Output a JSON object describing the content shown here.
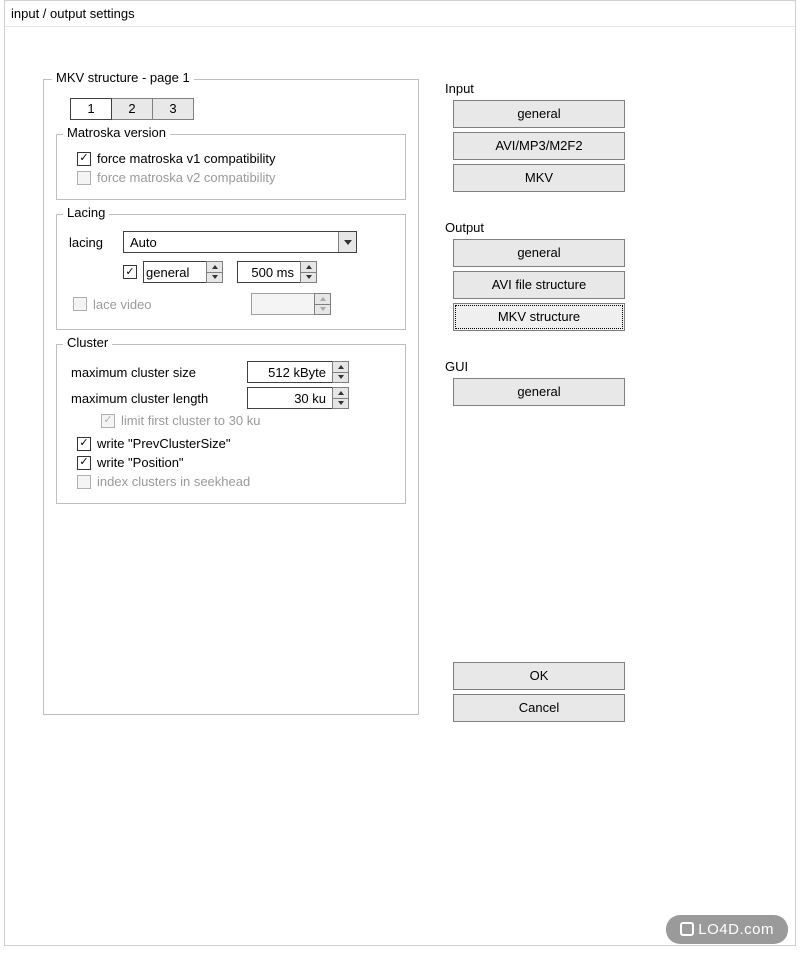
{
  "window": {
    "title": "input / output settings"
  },
  "left": {
    "structure_legend": "MKV structure - page 1",
    "pages": [
      "1",
      "2",
      "3"
    ],
    "active_page": 0,
    "matroska": {
      "legend": "Matroska version",
      "force_v1": {
        "label": "force matroska v1 compatibility",
        "checked": true,
        "enabled": true
      },
      "force_v2": {
        "label": "force matroska v2 compatibility",
        "checked": false,
        "enabled": false
      }
    },
    "lacing": {
      "legend": "Lacing",
      "label": "lacing",
      "mode": "Auto",
      "general_chk": true,
      "general_label": "general",
      "general_value": "",
      "ms_value": "500 ms",
      "lace_video": {
        "label": "lace video",
        "checked": false,
        "enabled": false
      },
      "lace_video_value": ""
    },
    "cluster": {
      "legend": "Cluster",
      "max_size_label": "maximum cluster size",
      "max_size_value": "512 kByte",
      "max_len_label": "maximum cluster length",
      "max_len_value": "30 ku",
      "limit30": {
        "label": "limit first cluster to 30 ku",
        "checked": true,
        "enabled": false
      },
      "prev_size": {
        "label": "write \"PrevClusterSize\"",
        "checked": true
      },
      "position": {
        "label": "write \"Position\"",
        "checked": true
      },
      "index_seek": {
        "label": "index clusters in seekhead",
        "checked": false,
        "enabled": false
      }
    }
  },
  "right": {
    "input_label": "Input",
    "input_buttons": [
      "general",
      "AVI/MP3/M2F2",
      "MKV"
    ],
    "output_label": "Output",
    "output_buttons": [
      "general",
      "AVI file structure",
      "MKV structure"
    ],
    "output_selected": 2,
    "gui_label": "GUI",
    "gui_buttons": [
      "general"
    ]
  },
  "actions": {
    "ok": "OK",
    "cancel": "Cancel"
  },
  "watermark": "LO4D.com"
}
